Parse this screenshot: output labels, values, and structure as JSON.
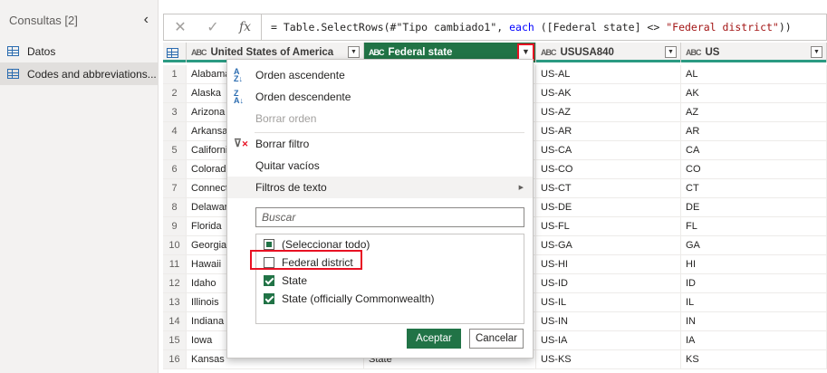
{
  "sidebar": {
    "title": "Consultas [2]",
    "collapse_glyph": "‹",
    "items": [
      {
        "label": "Datos",
        "icon": "table-icon"
      },
      {
        "label": "Codes and abbreviations...",
        "icon": "table-icon"
      }
    ]
  },
  "formula_bar": {
    "cancel_glyph": "✕",
    "commit_glyph": "✓",
    "fx": "fx",
    "p1": "= Table.SelectRows(#\"Tipo cambiado1\", ",
    "kw": "each",
    "p2": " ([Federal state] <> ",
    "str": "\"Federal district\"",
    "p3": "))"
  },
  "grid": {
    "columns": [
      {
        "type": "ABC",
        "label": "United States of America"
      },
      {
        "type": "ABC",
        "label": "Federal state"
      },
      {
        "type": "ABC",
        "label": "USUSA840"
      },
      {
        "type": "ABC",
        "label": "US"
      }
    ],
    "rows": [
      {
        "n": "1",
        "a": "Alabama",
        "b": "",
        "c": "US-AL",
        "d": "AL"
      },
      {
        "n": "2",
        "a": "Alaska",
        "b": "",
        "c": "US-AK",
        "d": "AK"
      },
      {
        "n": "3",
        "a": "Arizona",
        "b": "",
        "c": "US-AZ",
        "d": "AZ"
      },
      {
        "n": "4",
        "a": "Arkansas",
        "b": "",
        "c": "US-AR",
        "d": "AR"
      },
      {
        "n": "5",
        "a": "California",
        "b": "",
        "c": "US-CA",
        "d": "CA"
      },
      {
        "n": "6",
        "a": "Colorado",
        "b": "",
        "c": "US-CO",
        "d": "CO"
      },
      {
        "n": "7",
        "a": "Connecticut",
        "b": "",
        "c": "US-CT",
        "d": "CT"
      },
      {
        "n": "8",
        "a": "Delaware",
        "b": "",
        "c": "US-DE",
        "d": "DE"
      },
      {
        "n": "9",
        "a": "Florida",
        "b": "",
        "c": "US-FL",
        "d": "FL"
      },
      {
        "n": "10",
        "a": "Georgia",
        "b": "",
        "c": "US-GA",
        "d": "GA"
      },
      {
        "n": "11",
        "a": "Hawaii",
        "b": "",
        "c": "US-HI",
        "d": "HI"
      },
      {
        "n": "12",
        "a": "Idaho",
        "b": "",
        "c": "US-ID",
        "d": "ID"
      },
      {
        "n": "13",
        "a": "Illinois",
        "b": "",
        "c": "US-IL",
        "d": "IL"
      },
      {
        "n": "14",
        "a": "Indiana",
        "b": "",
        "c": "US-IN",
        "d": "IN"
      },
      {
        "n": "15",
        "a": "Iowa",
        "b": "",
        "c": "US-IA",
        "d": "IA"
      },
      {
        "n": "16",
        "a": "Kansas",
        "b": "State",
        "c": "US-KS",
        "d": "KS"
      }
    ]
  },
  "menu": {
    "sort_asc": "Orden ascendente",
    "sort_desc": "Orden descendente",
    "clear_sort": "Borrar orden",
    "clear_filter": "Borrar filtro",
    "remove_empty": "Quitar vacíos",
    "text_filters": "Filtros de texto",
    "search_placeholder": "Buscar",
    "options": [
      {
        "label": "(Seleccionar todo)",
        "state": "partial"
      },
      {
        "label": "Federal district",
        "state": "unchecked"
      },
      {
        "label": "State",
        "state": "checked"
      },
      {
        "label": "State (officially Commonwealth)",
        "state": "checked"
      }
    ],
    "ok": "Aceptar",
    "cancel": "Cancelar"
  },
  "colors": {
    "accent": "#217346",
    "highlight_box": "#e81123",
    "column_underline": "#2b9a82"
  }
}
